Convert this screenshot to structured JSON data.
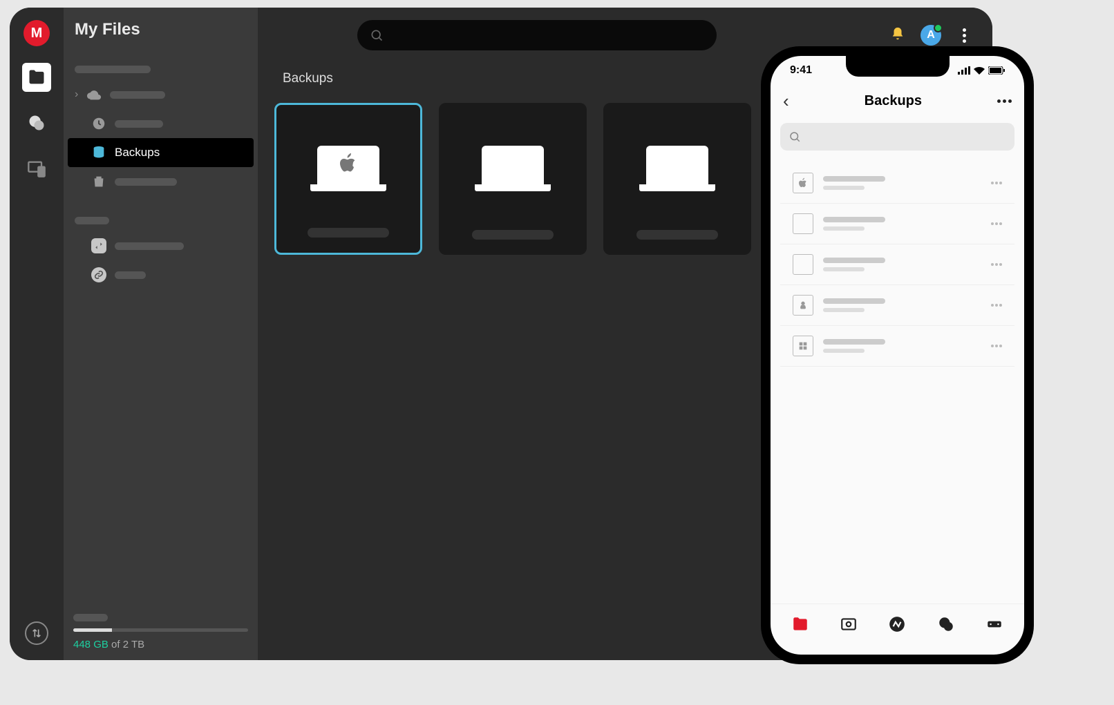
{
  "desktop": {
    "header_title": "My Files",
    "page_title": "Backups",
    "sidebar": {
      "backups_label": "Backups"
    },
    "storage": {
      "used": "448 GB",
      "total": "of 2 TB"
    },
    "avatar_initial": "A",
    "cards": [
      {
        "type": "mac",
        "selected": true
      },
      {
        "type": "generic",
        "selected": false
      },
      {
        "type": "generic",
        "selected": false
      },
      {
        "type": "windows",
        "selected": false
      }
    ]
  },
  "phone": {
    "time": "9:41",
    "title": "Backups",
    "rows": [
      "mac",
      "generic",
      "generic",
      "linux",
      "windows"
    ]
  }
}
